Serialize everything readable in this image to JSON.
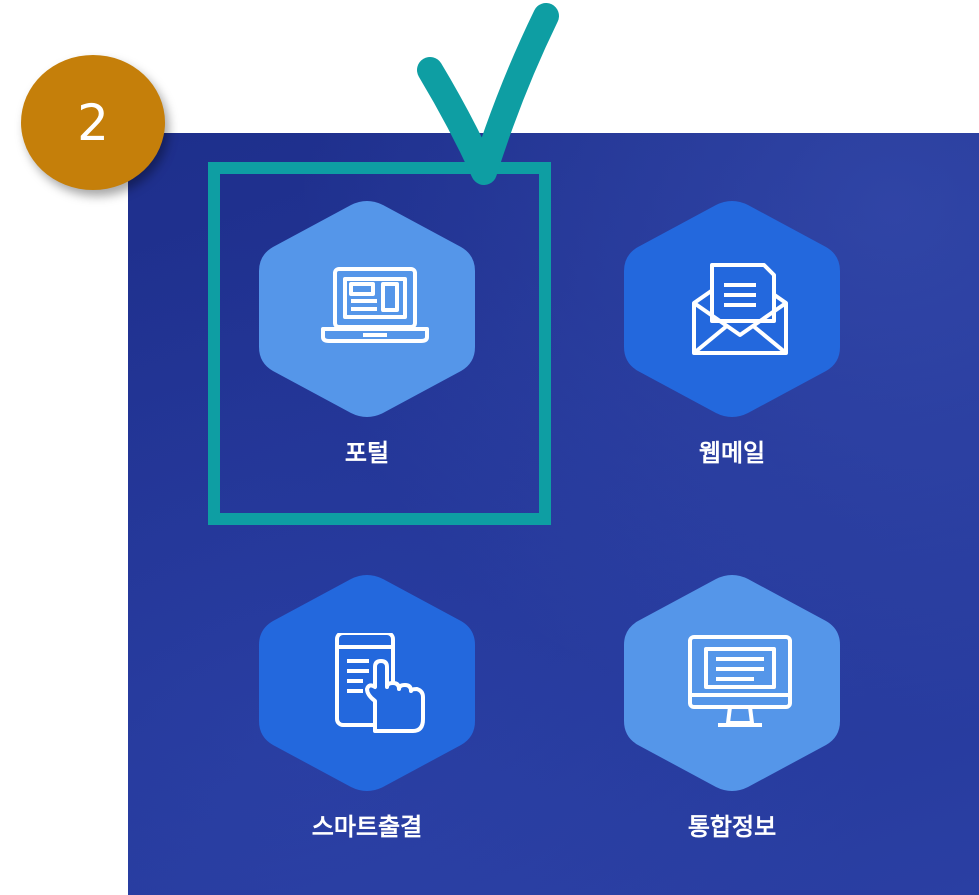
{
  "step_badge": {
    "number": "2",
    "color": "#c57f0a"
  },
  "annotation": {
    "highlight_color": "#0e9ea3",
    "checkmark": "check-icon"
  },
  "tiles": [
    {
      "label": "포털",
      "icon": "laptop-icon",
      "hex_color": "#5596e9",
      "selected": true
    },
    {
      "label": "웹메일",
      "icon": "mail-envelope-icon",
      "hex_color": "#2368dd",
      "selected": false
    },
    {
      "label": "스마트출결",
      "icon": "tablet-touch-icon",
      "hex_color": "#2368dd",
      "selected": false
    },
    {
      "label": "통합정보",
      "icon": "monitor-icon",
      "hex_color": "#5596e9",
      "selected": false
    }
  ],
  "colors": {
    "panel_bg": "#233596",
    "label_text": "#ffffff"
  }
}
